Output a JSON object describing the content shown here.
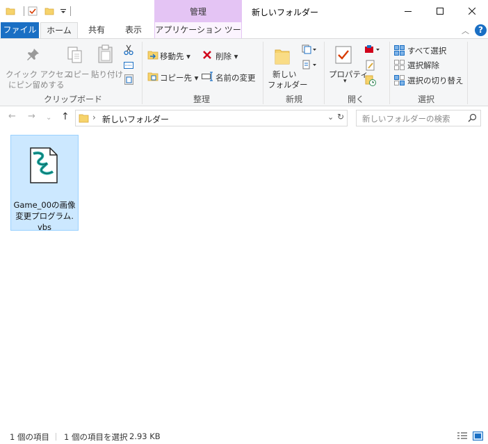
{
  "window": {
    "title": "新しいフォルダー",
    "context_tab_header": "管理"
  },
  "tabs": {
    "file": "ファイル",
    "home": "ホーム",
    "share": "共有",
    "view": "表示",
    "app_tools": "アプリケーション ツール"
  },
  "ribbon": {
    "clipboard": {
      "group_label": "クリップボード",
      "pin_line1": "クイック アクセス",
      "pin_line2": "にピン留めする",
      "copy": "コピー",
      "paste": "貼り付け"
    },
    "organize": {
      "group_label": "整理",
      "move_to": "移動先",
      "copy_to": "コピー先",
      "delete": "削除",
      "rename": "名前の変更"
    },
    "new": {
      "group_label": "新規",
      "new_folder_line1": "新しい",
      "new_folder_line2": "フォルダー"
    },
    "open": {
      "group_label": "開く",
      "properties": "プロパティ"
    },
    "select": {
      "group_label": "選択",
      "select_all": "すべて選択",
      "select_none": "選択解除",
      "invert_selection": "選択の切り替え"
    }
  },
  "address": {
    "path": "新しいフォルダー",
    "search_placeholder": "新しいフォルダーの検索"
  },
  "files": [
    {
      "name_line1": "Game_00の画像",
      "name_line2": "変更プログラム.",
      "name_line3": "vbs"
    }
  ],
  "status": {
    "item_count": "1 個の項目",
    "selected": "1 個の項目を選択",
    "size": "2.93 KB"
  },
  "colors": {
    "accent": "#1a6fc4",
    "context_tab": "#e4c4f4",
    "selection": "#cce8ff"
  }
}
